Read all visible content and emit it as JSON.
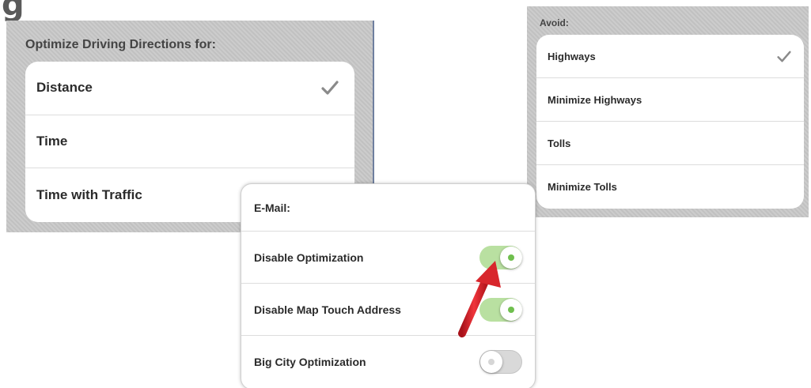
{
  "optimize": {
    "heading": "Optimize Driving Directions for:",
    "options": [
      {
        "label": "Distance",
        "checked": true
      },
      {
        "label": "Time",
        "checked": false
      },
      {
        "label": "Time with Traffic",
        "checked": false
      }
    ]
  },
  "avoid": {
    "heading": "Avoid:",
    "options": [
      {
        "label": "Highways",
        "checked": true
      },
      {
        "label": "Minimize Highways",
        "checked": false
      },
      {
        "label": "Tolls",
        "checked": false
      },
      {
        "label": "Minimize Tolls",
        "checked": false
      }
    ]
  },
  "settings": {
    "email_label": "E-Mail:",
    "toggles": [
      {
        "label": "Disable Optimization",
        "state": "on"
      },
      {
        "label": "Disable Map Touch Address",
        "state": "on"
      },
      {
        "label": "Big City Optimization",
        "state": "off"
      }
    ]
  },
  "icons": {
    "check": "check-icon",
    "toggle": "toggle-switch",
    "annotation": "red-arrow-icon"
  },
  "colors": {
    "panel_background": "#c9c9c9",
    "toggle_on": "#b9e0a1",
    "toggle_knob_dot_on": "#6fbf4e",
    "toggle_off": "#d9d9d9",
    "check_mark": "#8a8a8a",
    "arrow": "#e0242a"
  },
  "corner_glyph": "g"
}
